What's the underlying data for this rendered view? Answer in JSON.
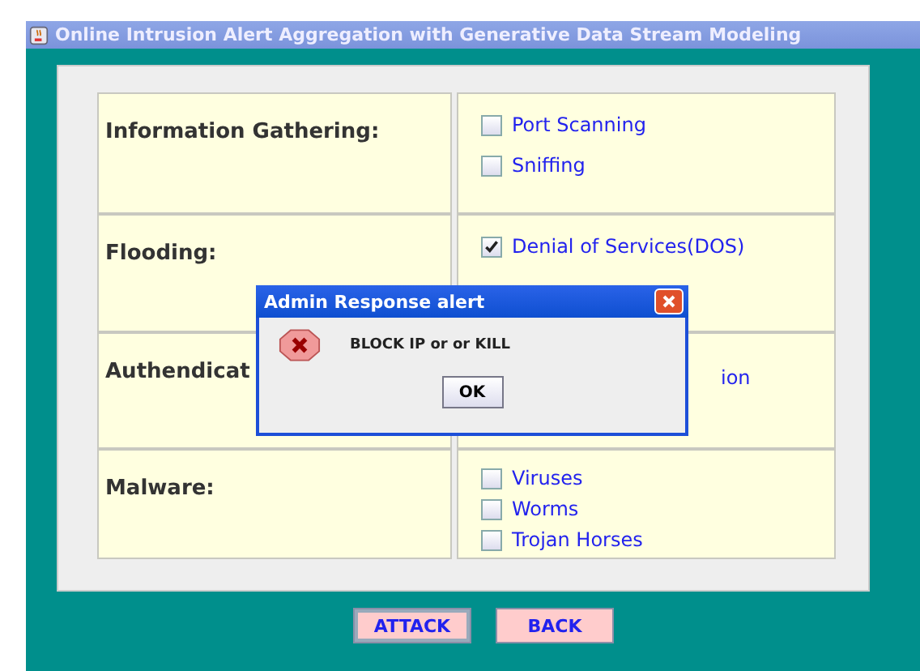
{
  "window": {
    "title": "Online Intrusion Alert Aggregation with Generative Data Stream Modeling"
  },
  "categories": [
    {
      "label": "Information Gathering:",
      "items": [
        {
          "kind": "checkbox",
          "label": "Port Scanning",
          "checked": false
        },
        {
          "kind": "checkbox",
          "label": "Sniffing",
          "checked": false
        }
      ]
    },
    {
      "label": "Flooding:",
      "items": [
        {
          "kind": "checkbox",
          "label": "Denial of Services(DOS)",
          "checked": true
        }
      ]
    },
    {
      "label": "Authendicat",
      "items": [
        {
          "kind": "fragment",
          "label": "ion"
        }
      ]
    },
    {
      "label": "Malware:",
      "items": [
        {
          "kind": "checkbox",
          "label": "Viruses",
          "checked": false
        },
        {
          "kind": "checkbox",
          "label": "Worms",
          "checked": false
        },
        {
          "kind": "checkbox",
          "label": "Trojan Horses",
          "checked": false
        }
      ]
    }
  ],
  "buttons": [
    {
      "label": "ATTACK",
      "selected": true
    },
    {
      "label": "BACK",
      "selected": false
    }
  ],
  "dialog": {
    "title": "Admin Response alert",
    "message": "BLOCK IP or or KILL",
    "button": "OK"
  }
}
